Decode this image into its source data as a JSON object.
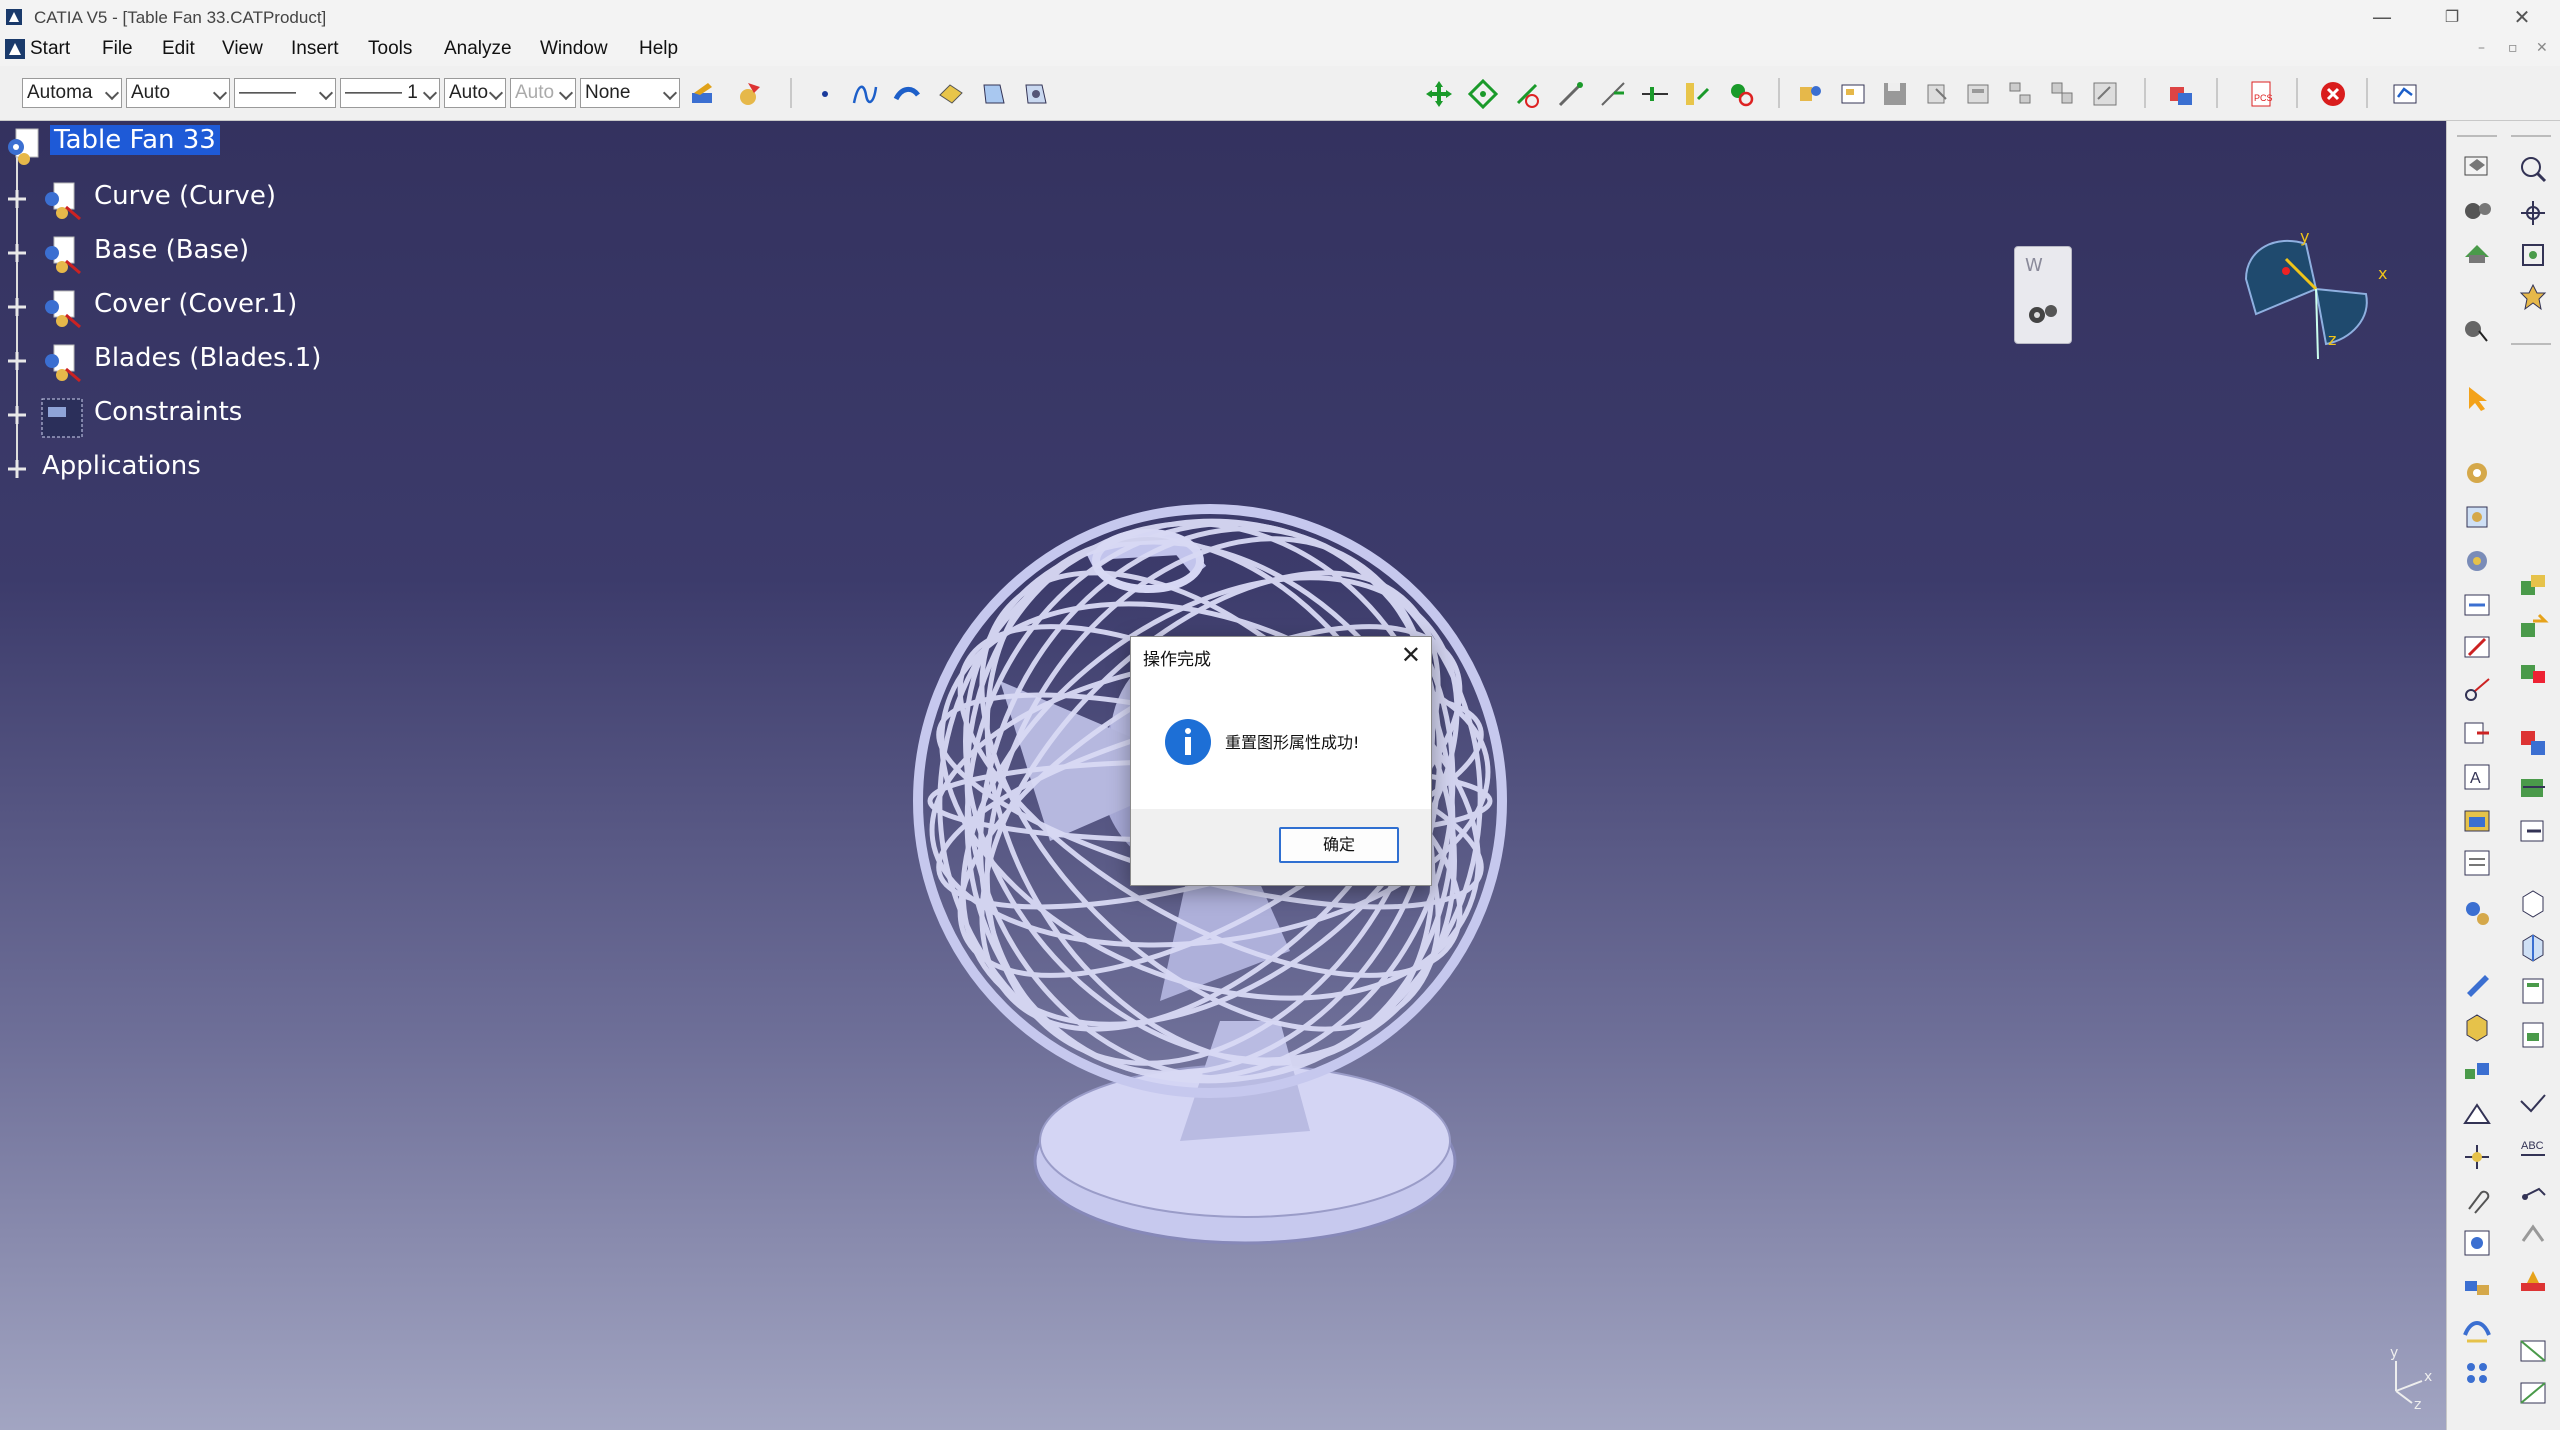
{
  "window": {
    "title": "CATIA V5 - [Table Fan 33.CATProduct]",
    "minimize": "—",
    "restore": "❐",
    "close": "✕"
  },
  "menu": {
    "items": [
      "Start",
      "File",
      "Edit",
      "View",
      "Insert",
      "Tools",
      "Analyze",
      "Window",
      "Help"
    ]
  },
  "toolbar": {
    "combos": [
      "Automa",
      "Auto",
      "———",
      "——— 1",
      "Auto",
      "Auto",
      "None"
    ]
  },
  "tree": {
    "root": "Table Fan 33",
    "children": [
      "Curve (Curve)",
      "Base (Base)",
      "Cover (Cover.1)",
      "Blades (Blades.1)",
      "Constraints",
      "Applications"
    ]
  },
  "compass": {
    "x": "x",
    "y": "y",
    "z": "z"
  },
  "axis": {
    "x": "x",
    "y": "y",
    "z": "z"
  },
  "mini_panel": {
    "label": "W"
  },
  "dialog": {
    "title": "操作完成",
    "message": "重置图形属性成功!",
    "ok": "确定"
  }
}
